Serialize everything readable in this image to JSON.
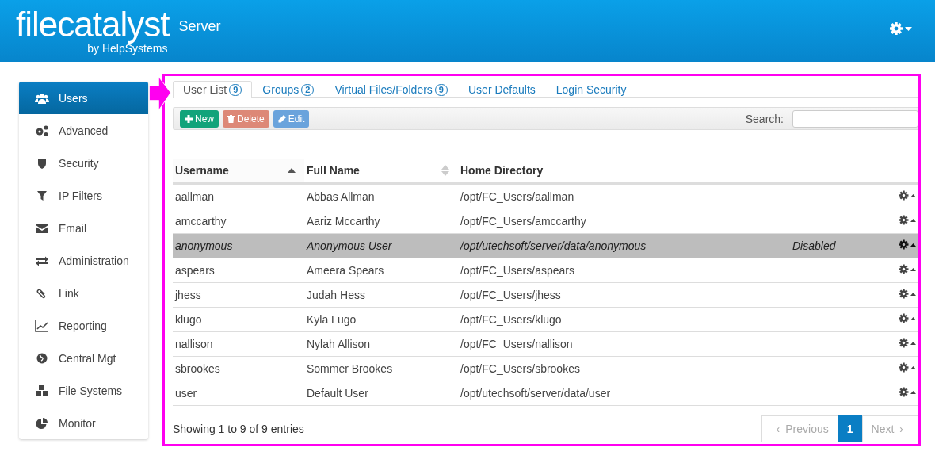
{
  "header": {
    "logo_main": "filecatalyst",
    "logo_sub": "by HelpSystems",
    "product": "Server"
  },
  "sidebar": {
    "items": [
      {
        "label": "Users",
        "selected": true
      },
      {
        "label": "Advanced",
        "selected": false
      },
      {
        "label": "Security",
        "selected": false
      },
      {
        "label": "IP Filters",
        "selected": false
      },
      {
        "label": "Email",
        "selected": false
      },
      {
        "label": "Administration",
        "selected": false
      },
      {
        "label": "Link",
        "selected": false
      },
      {
        "label": "Reporting",
        "selected": false
      },
      {
        "label": "Central Mgt",
        "selected": false
      },
      {
        "label": "File Systems",
        "selected": false
      },
      {
        "label": "Monitor",
        "selected": false
      }
    ]
  },
  "tabs": [
    {
      "label": "User List",
      "count": "9",
      "selected": true
    },
    {
      "label": "Groups",
      "count": "2",
      "selected": false
    },
    {
      "label": "Virtual Files/Folders",
      "count": "9",
      "selected": false
    },
    {
      "label": "User Defaults",
      "selected": false
    },
    {
      "label": "Login Security",
      "selected": false
    }
  ],
  "toolbar": {
    "buttons": [
      {
        "label": "New",
        "kind": "new"
      },
      {
        "label": "Delete",
        "kind": "delete"
      },
      {
        "label": "Edit",
        "kind": "edit"
      }
    ],
    "search_label": "Search:"
  },
  "table": {
    "columns": [
      {
        "label": "Username",
        "sortable": true,
        "sorted": true
      },
      {
        "label": "Full Name",
        "sortable": true,
        "sorted": false
      },
      {
        "label": "Home Directory",
        "sortable": false
      }
    ],
    "rows": [
      {
        "username": "aallman",
        "full_name": "Abbas Allman",
        "home": "/opt/FC_Users/aallman",
        "disabled": false
      },
      {
        "username": "amccarthy",
        "full_name": "Aariz Mccarthy",
        "home": "/opt/FC_Users/amccarthy",
        "disabled": false
      },
      {
        "username": "anonymous",
        "full_name": "Anonymous User",
        "home": "/opt/utechsoft/server/data/anonymous",
        "disabled": true,
        "status": "Disabled"
      },
      {
        "username": "aspears",
        "full_name": "Ameera Spears",
        "home": "/opt/FC_Users/aspears",
        "disabled": false
      },
      {
        "username": "jhess",
        "full_name": "Judah Hess",
        "home": "/opt/FC_Users/jhess",
        "disabled": false
      },
      {
        "username": "klugo",
        "full_name": "Kyla Lugo",
        "home": "/opt/FC_Users/klugo",
        "disabled": false
      },
      {
        "username": "nallison",
        "full_name": "Nylah Allison",
        "home": "/opt/FC_Users/nallison",
        "disabled": false
      },
      {
        "username": "sbrookes",
        "full_name": "Sommer Brookes",
        "home": "/opt/FC_Users/sbrookes",
        "disabled": false
      },
      {
        "username": "user",
        "full_name": "Default User",
        "home": "/opt/utechsoft/server/data/user",
        "disabled": false
      }
    ]
  },
  "footer": {
    "info": "Showing 1 to 9 of 9 entries",
    "pagination": [
      {
        "label": "Previous",
        "icon": "‹",
        "kind": "prev",
        "disabled": true
      },
      {
        "label": "1",
        "kind": "page",
        "selected": true
      },
      {
        "label": "Next",
        "icon": "›",
        "kind": "next",
        "disabled": true
      }
    ]
  }
}
